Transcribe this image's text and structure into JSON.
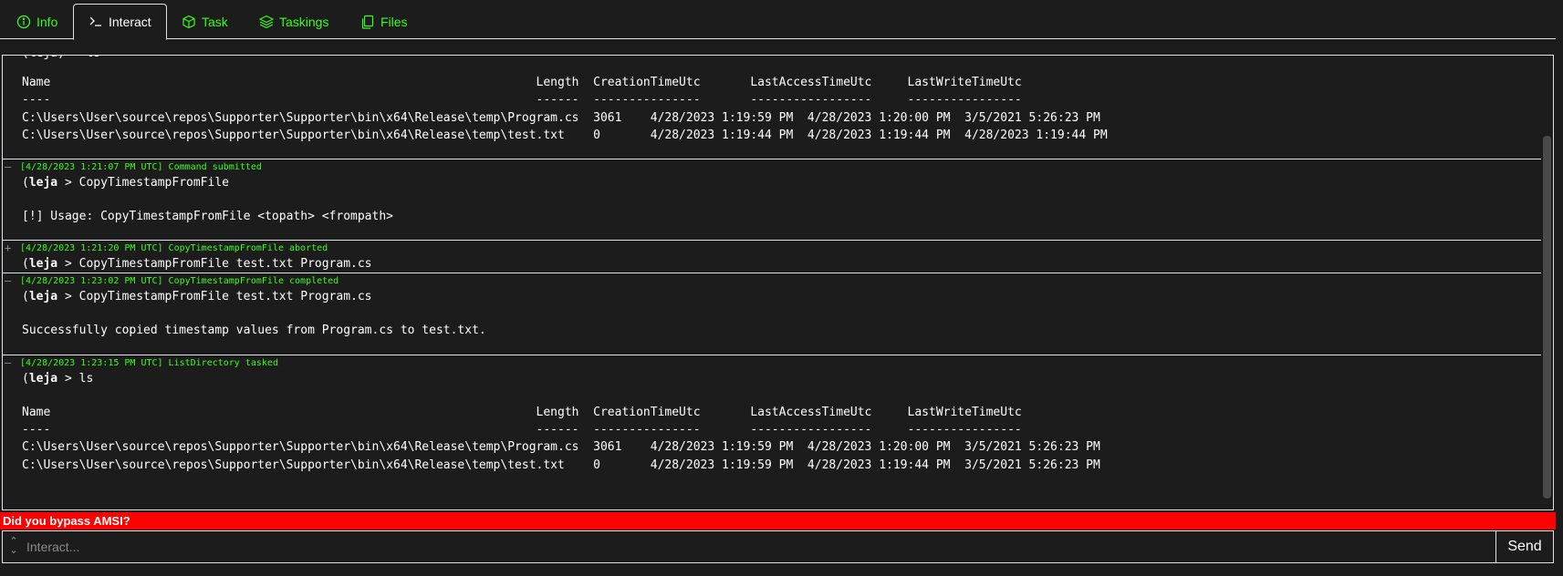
{
  "tabs": [
    {
      "label": "Info",
      "icon": "info-circle-icon"
    },
    {
      "label": "Interact",
      "icon": "terminal-icon"
    },
    {
      "label": "Task",
      "icon": "cube-icon"
    },
    {
      "label": "Taskings",
      "icon": "layers-icon"
    },
    {
      "label": "Files",
      "icon": "files-icon"
    }
  ],
  "colors": {
    "accent": "#39ff14",
    "warning_bg": "#ff0000",
    "background": "#1c1c1d",
    "border": "#dee2e6"
  },
  "console": {
    "top_fragment": "(leja) > ls",
    "first_output": "Name                                                                    Length  CreationTimeUtc       LastAccessTimeUtc     LastWriteTimeUtc\n----                                                                    ------  ---------------       -----------------     ----------------\nC:\\Users\\User\\source\\repos\\Supporter\\Supporter\\bin\\x64\\Release\\temp\\Program.cs  3061    4/28/2023 1:19:59 PM  4/28/2023 1:20:00 PM  3/5/2021 5:26:23 PM\nC:\\Users\\User\\source\\repos\\Supporter\\Supporter\\bin\\x64\\Release\\temp\\test.txt    0       4/28/2023 1:19:44 PM  4/28/2023 1:19:44 PM  4/28/2023 1:19:44 PM",
    "entries": [
      {
        "toggle": "—",
        "meta": "[4/28/2023 1:21:07 PM UTC] Command submitted",
        "agent": "leja",
        "command": " > CopyTimestampFromFile",
        "output": "[!] Usage: CopyTimestampFromFile <topath> <frompath>"
      },
      {
        "toggle": "+",
        "meta": "[4/28/2023 1:21:20 PM UTC] CopyTimestampFromFile aborted",
        "agent": "leja",
        "command": " > CopyTimestampFromFile test.txt Program.cs",
        "output": ""
      },
      {
        "toggle": "—",
        "meta": "[4/28/2023 1:23:02 PM UTC] CopyTimestampFromFile completed",
        "agent": "leja",
        "command": " > CopyTimestampFromFile test.txt Program.cs",
        "output": "Successfully copied timestamp values from Program.cs to test.txt."
      },
      {
        "toggle": "—",
        "meta": "[4/28/2023 1:23:15 PM UTC] ListDirectory tasked",
        "agent": "leja",
        "command": " > ls",
        "output": "Name                                                                    Length  CreationTimeUtc       LastAccessTimeUtc     LastWriteTimeUtc\n----                                                                    ------  ---------------       -----------------     ----------------\nC:\\Users\\User\\source\\repos\\Supporter\\Supporter\\bin\\x64\\Release\\temp\\Program.cs  3061    4/28/2023 1:19:59 PM  4/28/2023 1:20:00 PM  3/5/2021 5:26:23 PM\nC:\\Users\\User\\source\\repos\\Supporter\\Supporter\\bin\\x64\\Release\\temp\\test.txt    0       4/28/2023 1:19:59 PM  4/28/2023 1:19:44 PM  3/5/2021 5:26:23 PM"
      }
    ]
  },
  "warning": "Did you bypass AMSI?",
  "input": {
    "placeholder": "Interact...",
    "value": ""
  },
  "send_label": "Send"
}
